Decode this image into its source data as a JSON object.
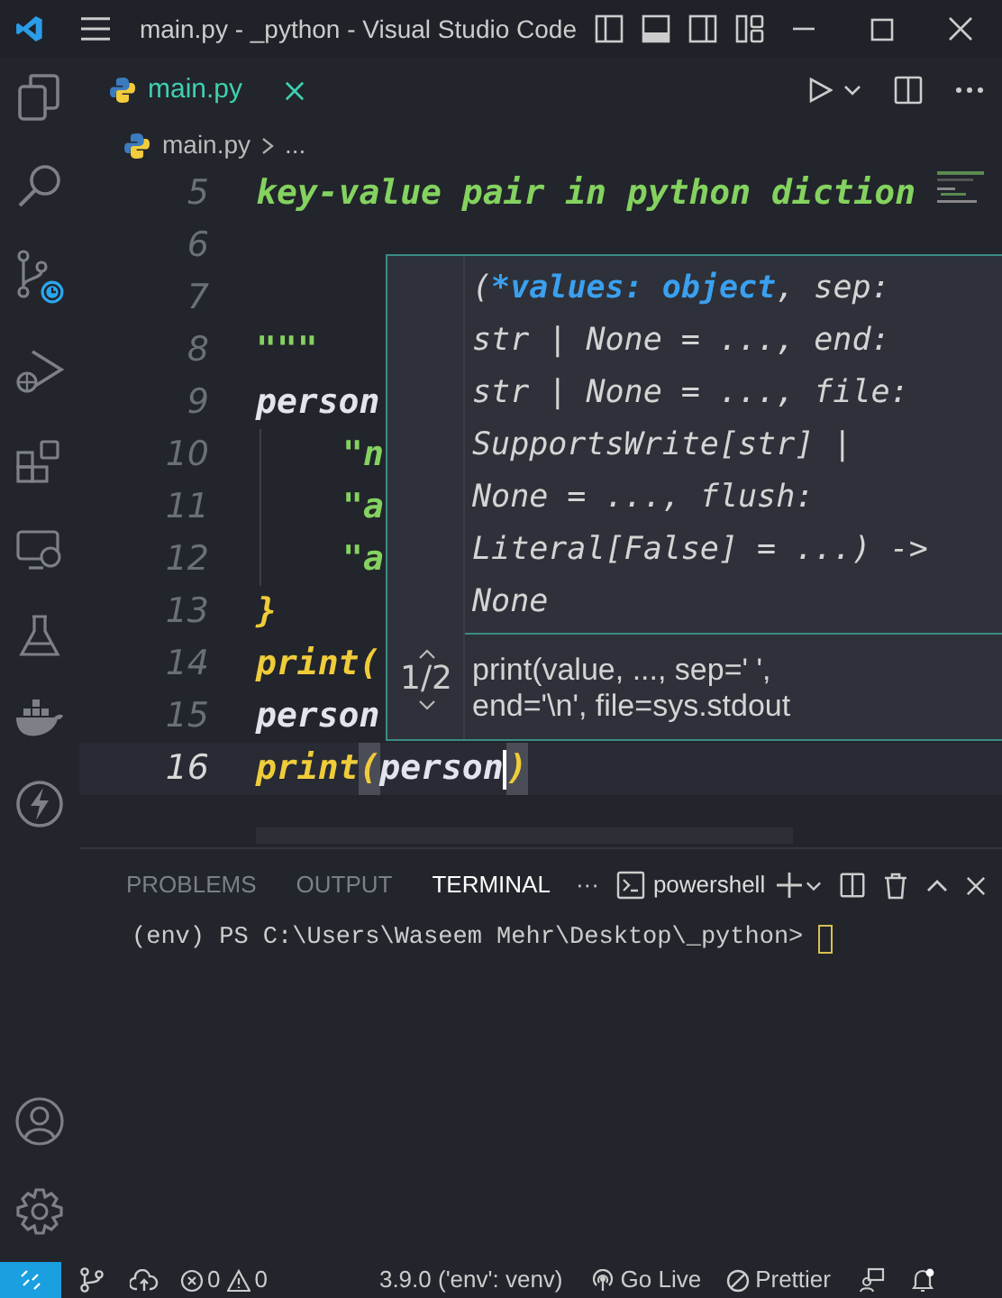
{
  "window": {
    "title": "main.py - _python - Visual Studio Code"
  },
  "tabs": [
    {
      "label": "main.py",
      "selected": true
    }
  ],
  "breadcrumb": [
    "main.py",
    "..."
  ],
  "editor": {
    "lines": [
      {
        "number": "5",
        "current": false,
        "tokens": [
          {
            "kind": "string",
            "text": "key-value pair in python diction"
          }
        ]
      },
      {
        "number": "6",
        "current": false
      },
      {
        "number": "7",
        "current": false
      },
      {
        "number": "8",
        "current": false,
        "tokens": [
          {
            "kind": "string",
            "text": "\"\"\""
          }
        ]
      },
      {
        "number": "9",
        "current": false,
        "tokens": [
          {
            "kind": "name",
            "text": "person"
          }
        ]
      },
      {
        "number": "10",
        "current": false,
        "indented": true,
        "tokens": [
          {
            "kind": "string",
            "text": "\"n"
          }
        ]
      },
      {
        "number": "11",
        "current": false,
        "indented": true,
        "tokens": [
          {
            "kind": "string",
            "text": "\"a"
          }
        ]
      },
      {
        "number": "12",
        "current": false,
        "indented": true,
        "tokens": [
          {
            "kind": "string",
            "text": "\"a"
          }
        ]
      },
      {
        "number": "13",
        "current": false,
        "tokens": [
          {
            "kind": "func",
            "text": "}"
          }
        ]
      },
      {
        "number": "14",
        "current": false,
        "tokens": [
          {
            "kind": "func",
            "text": "print("
          }
        ]
      },
      {
        "number": "15",
        "current": false,
        "tokens": [
          {
            "kind": "name",
            "text": "person"
          }
        ]
      },
      {
        "number": "16",
        "current": true,
        "tokens": [
          {
            "kind": "func",
            "text": "print"
          },
          {
            "kind": "bracket_match",
            "text": "("
          },
          {
            "kind": "name",
            "text": "person",
            "cursor_after": true
          },
          {
            "kind": "bracket_match",
            "text": ")"
          }
        ]
      }
    ]
  },
  "hover": {
    "counter": "1/2",
    "signature": [
      [
        {
          "kind": "plain",
          "text": "("
        },
        {
          "kind": "param",
          "text": "*values: object"
        },
        {
          "kind": "plain",
          "text": ", sep:"
        }
      ],
      [
        {
          "kind": "plain",
          "text": "str | None = ..., end:"
        }
      ],
      [
        {
          "kind": "plain",
          "text": "str | None = ..., file:"
        }
      ],
      [
        {
          "kind": "plain",
          "text": "SupportsWrite[str] |"
        }
      ],
      [
        {
          "kind": "plain",
          "text": "None = ..., flush:"
        }
      ],
      [
        {
          "kind": "plain",
          "text": "Literal[False] = ...) ->"
        }
      ],
      [
        {
          "kind": "plain",
          "text": "None"
        }
      ]
    ],
    "doc": [
      "print(value, ..., sep=' ',",
      "end='\\n', file=sys.stdout"
    ]
  },
  "panel": {
    "tabs": [
      {
        "label": "PROBLEMS",
        "selected": false
      },
      {
        "label": "OUTPUT",
        "selected": false
      },
      {
        "label": "TERMINAL",
        "selected": true
      }
    ],
    "more": "···",
    "shell": "powershell",
    "terminal_line": "(env) PS C:\\Users\\Waseem Mehr\\Desktop\\_python> "
  },
  "status_bar": {
    "errors": "0",
    "warnings": "0",
    "interpreter": "3.9.0 ('env': venv)",
    "go_live": "Go Live",
    "prettier": "Prettier"
  }
}
